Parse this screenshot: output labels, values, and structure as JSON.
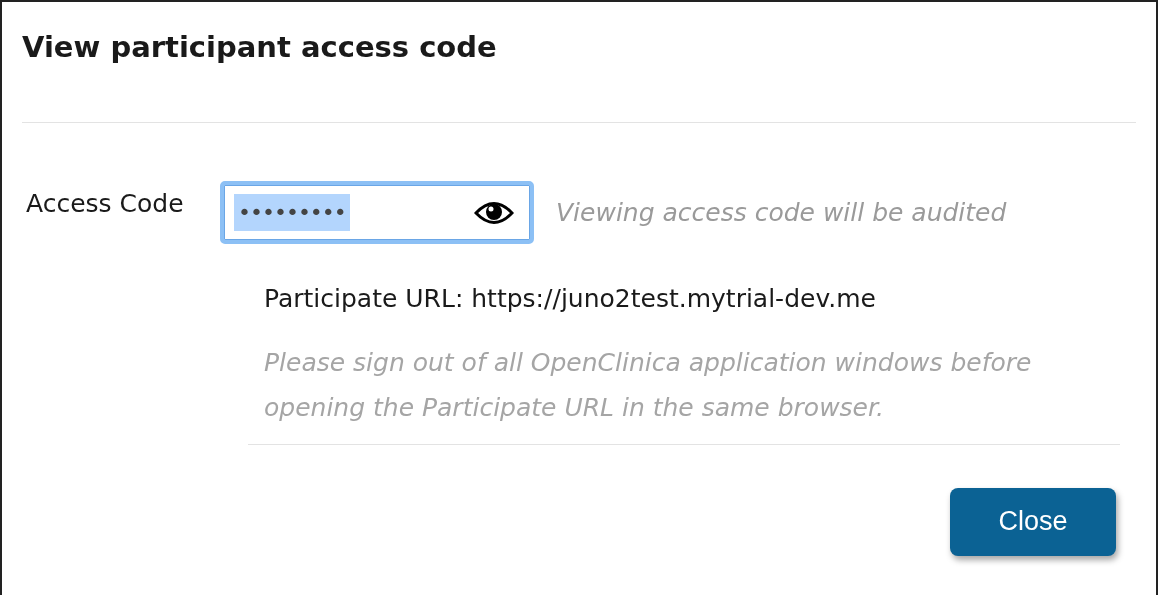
{
  "dialog": {
    "title": "View participant access code"
  },
  "access_code": {
    "label": "Access Code",
    "value": "•••••••••",
    "value_highlighted": true,
    "focused": true,
    "hint": "Viewing access code will be audited"
  },
  "participate_url": "Participate URL: https://juno2test.mytrial-dev.me",
  "note": "Please sign out of all OpenClinica application windows before opening the Participate URL in the same browser.",
  "buttons": [
    {
      "label": "Close"
    }
  ]
}
